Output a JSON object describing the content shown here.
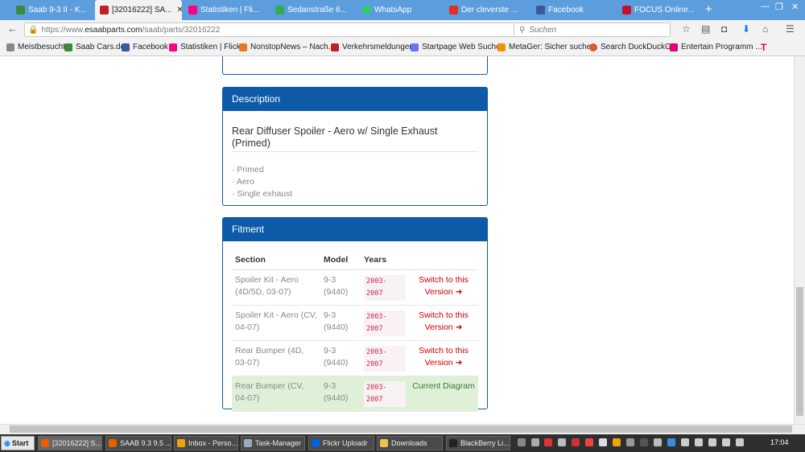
{
  "browser": {
    "tabs": [
      {
        "label": "Saab 9-3 II - K...",
        "color": "#3c8a3c"
      },
      {
        "label": "[32016222] SA...",
        "color": "#c41e2a"
      },
      {
        "label": "Statistiken | Fli...",
        "color": "#ff0084"
      },
      {
        "label": "Sedanstraße 6...",
        "color": "#34a853"
      },
      {
        "label": "WhatsApp",
        "color": "#25d366"
      },
      {
        "label": "Der cleverste ...",
        "color": "#e52d27"
      },
      {
        "label": "Facebook",
        "color": "#3b5998"
      },
      {
        "label": "FOCUS Online...",
        "color": "#c8102e"
      }
    ],
    "url_prefix": "https://www.",
    "url_host": "esaabparts.com",
    "url_path": "/saab/parts/32016222",
    "search_placeholder": "Suchen",
    "bookmarks": [
      "Meistbesucht",
      "Saab Cars.de",
      "Facebook",
      "Statistiken | Flickr",
      "NonstopNews – Nach...",
      "Verkehrsmeldungen",
      "Startpage Web Suchen",
      "MetaGer: Sicher suche...",
      "Search DuckDuckGo",
      "Entertain Programm ..."
    ]
  },
  "description": {
    "heading": "Description",
    "title": "Rear Diffuser Spoiler - Aero w/ Single Exhaust (Primed)",
    "features": [
      "· Primed",
      "· Aero",
      "· Single exhaust"
    ]
  },
  "fitment": {
    "heading": "Fitment",
    "columns": [
      "Section",
      "Model",
      "Years"
    ],
    "rows": [
      {
        "section": "Spoiler Kit - Aero (4D/5D, 03-07)",
        "model": "9-3 (9440)",
        "years": "2003-2007",
        "action": "Switch to this Version ➜"
      },
      {
        "section": "Spoiler Kit - Aero (CV, 04-07)",
        "model": "9-3 (9440)",
        "years": "2003-2007",
        "action": "Switch to this Version ➜"
      },
      {
        "section": "Rear Bumper (4D, 03-07)",
        "model": "9-3 (9440)",
        "years": "2003-2007",
        "action": "Switch to this Version ➜"
      },
      {
        "section": "Rear Bumper (CV, 04-07)",
        "model": "9-3 (9440)",
        "years": "2003-2007",
        "action": "Current Diagram"
      }
    ]
  },
  "taskbar": {
    "start": "Start",
    "items": [
      "[32016222] S...",
      "SAAB 9.3 9.5 ...",
      "Inbox - Perso...",
      "Task-Manager",
      "Flickr Uploadr",
      "Downloads",
      "BlackBerry Li..."
    ],
    "clock": "17:04"
  }
}
